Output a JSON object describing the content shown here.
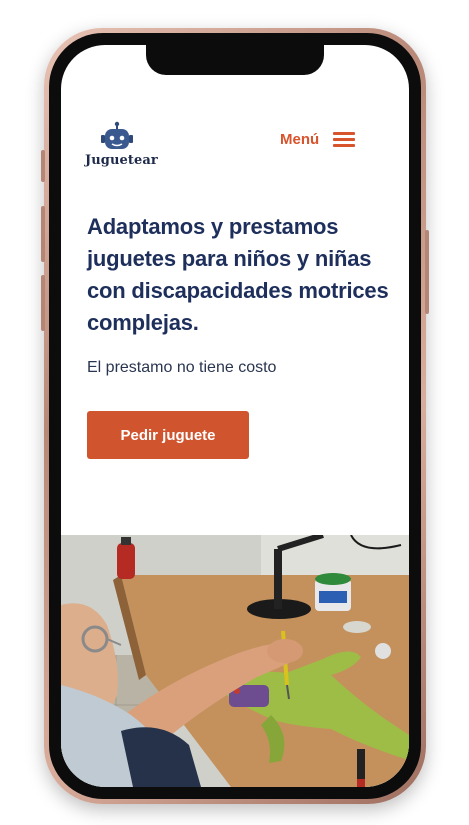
{
  "brand": {
    "name": "Juguetear"
  },
  "header": {
    "menu_label": "Menú"
  },
  "hero": {
    "title": "Adaptamos y prestamos juguetes para niños y niñas con discapacidades motrices complejas.",
    "subtitle": "El prestamo no tiene costo",
    "cta_label": "Pedir juguete"
  },
  "icons": {
    "logo": "robot-face-icon",
    "menu": "hamburger-menu-icon"
  },
  "colors": {
    "accent": "#d0552e",
    "heading": "#1e2f5c",
    "frame": "#b88877"
  }
}
